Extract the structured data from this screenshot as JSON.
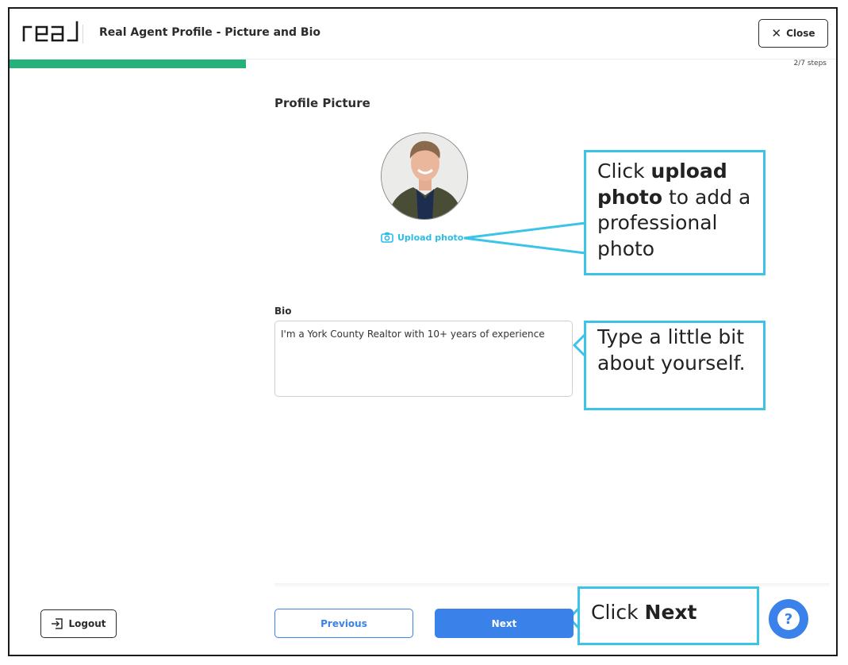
{
  "header": {
    "logo_text": "real",
    "title": "Real Agent Profile - Picture and Bio",
    "close_label": "Close"
  },
  "progress": {
    "fraction": 0.2857,
    "steps_label": "2/7 steps",
    "color": "#26b17a"
  },
  "profile_picture": {
    "section_title": "Profile Picture",
    "upload_label": "Upload photo"
  },
  "bio": {
    "label": "Bio",
    "value": "I'm a York County Realtor with 10+ years of experience"
  },
  "callouts": {
    "upload": {
      "pre": "Click ",
      "bold": "upload photo",
      "post": " to add a professional photo"
    },
    "bio": {
      "text": "Type a little bit about yourself."
    },
    "next": {
      "pre": "Click ",
      "bold": "Next"
    }
  },
  "footer": {
    "logout_label": "Logout",
    "previous_label": "Previous",
    "next_label": "Next",
    "help_symbol": "?"
  },
  "colors": {
    "accent_blue": "#3a82ea",
    "callout_cyan": "#3cc3e8",
    "progress_green": "#26b17a"
  },
  "icons": {
    "logout": "logout-icon",
    "camera": "camera-icon",
    "close": "close-icon",
    "help": "help-icon"
  }
}
